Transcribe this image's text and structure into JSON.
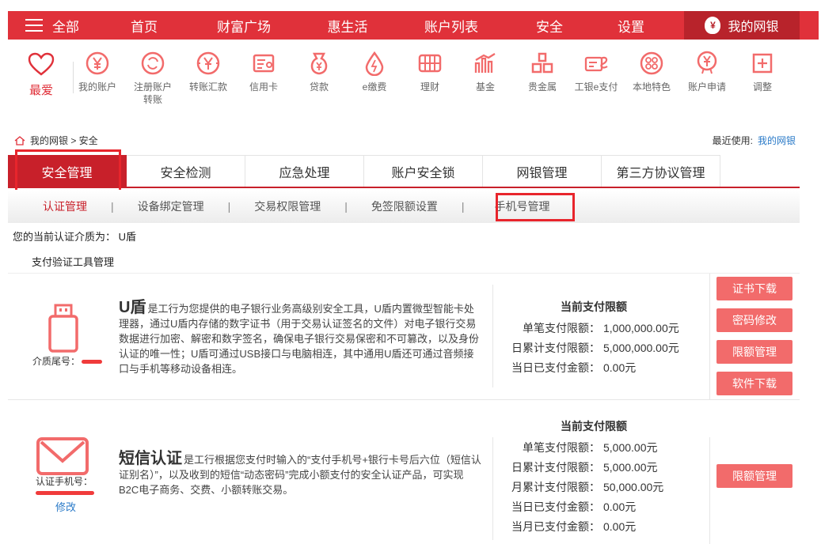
{
  "topnav": {
    "all_label": "全部",
    "items": [
      "首页",
      "财富广场",
      "惠生活",
      "账户列表",
      "安全",
      "设置"
    ],
    "mybank_label": "我的网银",
    "accent": "#e0313a",
    "dark_accent": "#b8232b"
  },
  "favorites": {
    "label": "最爱"
  },
  "quick_icons": [
    {
      "label": "我的账户",
      "icon": "yen-circle-icon"
    },
    {
      "label": "注册账户\n转账",
      "icon": "transfer-icon"
    },
    {
      "label": "转账汇款",
      "icon": "remit-icon"
    },
    {
      "label": "信用卡",
      "icon": "credit-card-icon"
    },
    {
      "label": "贷款",
      "icon": "money-bag-icon"
    },
    {
      "label": "e缴费",
      "icon": "drop-icon"
    },
    {
      "label": "理财",
      "icon": "abacus-icon"
    },
    {
      "label": "基金",
      "icon": "bar-chart-icon"
    },
    {
      "label": "贵金属",
      "icon": "gold-bars-icon"
    },
    {
      "label": "工银e支付",
      "icon": "epay-icon"
    },
    {
      "label": "本地特色",
      "icon": "dots-icon"
    },
    {
      "label": "账户申请",
      "icon": "yen-person-icon"
    },
    {
      "label": "调整",
      "icon": "plus-box-icon"
    }
  ],
  "breadcrumb": {
    "text": "我的网银 > 安全"
  },
  "recent": {
    "label": "最近使用:",
    "link": "我的网银"
  },
  "tabs": [
    "安全管理",
    "安全检测",
    "应急处理",
    "账户安全锁",
    "网银管理",
    "第三方协议管理"
  ],
  "subtabs": [
    "认证管理",
    "设备绑定管理",
    "交易权限管理",
    "免签限额设置",
    "手机号管理"
  ],
  "current_medium": "您的当前认证介质为： U盾",
  "pay_tool_header": "支付验证工具管理",
  "ushield": {
    "title": "U盾",
    "description": "是工行为您提供的电子银行业务高级别安全工具，U盾内置微型智能卡处理器，通过U盾内存储的数字证书（用于交易认证签名的文件）对电子银行交易数据进行加密、解密和数字签名，确保电子银行交易保密和不可篡改，以及身份认证的唯一性；U盾可通过USB接口与电脑相连，其中通用U盾还可通过音频接口与手机等移动设备相连。",
    "medium_label": "介质尾号：",
    "limit_title": "当前支付限额",
    "limits": [
      {
        "k": "单笔支付限额：",
        "v": "1,000,000.00元"
      },
      {
        "k": "日累计支付限额：",
        "v": "5,000,000.00元"
      },
      {
        "k": "当日已支付金额：",
        "v": "0.00元"
      }
    ],
    "buttons": [
      "证书下载",
      "密码修改",
      "限额管理",
      "软件下载"
    ]
  },
  "sms": {
    "title": "短信认证",
    "description": "是工行根据您支付时输入的“支付手机号+银行卡号后六位（短信认证别名）”，以及收到的短信“动态密码”完成小额支付的安全认证产品，可实现B2C电子商务、交费、小额转账交易。",
    "phone_label": "认证手机号：",
    "modify_label": "修改",
    "limit_title": "当前支付限额",
    "limits": [
      {
        "k": "单笔支付限额：",
        "v": "5,000.00元"
      },
      {
        "k": "日累计支付限额：",
        "v": "5,000.00元"
      },
      {
        "k": "月累计支付限额：",
        "v": "50,000.00元"
      },
      {
        "k": "当日已支付金额：",
        "v": "0.00元"
      },
      {
        "k": "当月已支付金额：",
        "v": "0.00元"
      }
    ],
    "buttons": [
      "限额管理"
    ]
  }
}
